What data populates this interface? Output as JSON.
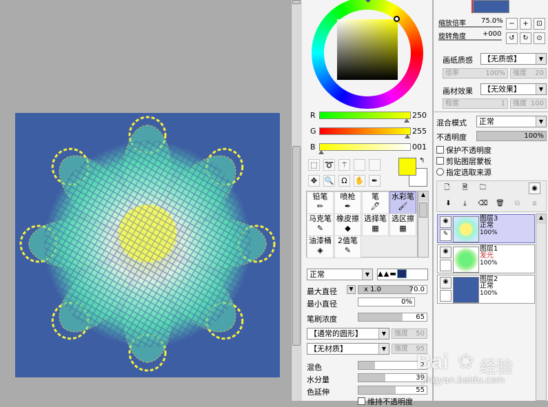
{
  "colors": {
    "canvas_bg": "#3e5ea3",
    "primary_color": "#fafa00",
    "secondary_color": "#ffffff",
    "selected_bg": "#c8c8f0"
  },
  "rgb": {
    "r_label": "R",
    "r_value": "250",
    "g_label": "G",
    "g_value": "255",
    "b_label": "B",
    "b_value": "001"
  },
  "tools": [
    {
      "label": "铅笔",
      "icon": "pencil-icon",
      "glyph": "✏"
    },
    {
      "label": "喷枪",
      "icon": "airbrush-icon",
      "glyph": "✒"
    },
    {
      "label": "笔",
      "icon": "pen-icon",
      "glyph": "🖊"
    },
    {
      "label": "水彩笔",
      "icon": "watercolor-icon",
      "glyph": "🖌",
      "selected": true
    },
    {
      "label": "马克笔",
      "icon": "marker-icon",
      "glyph": "✎"
    },
    {
      "label": "橡皮擦",
      "icon": "eraser-icon",
      "glyph": "◆"
    },
    {
      "label": "选择笔",
      "icon": "selection-pen-icon",
      "glyph": "▦"
    },
    {
      "label": "选区擦",
      "icon": "selection-eraser-icon",
      "glyph": "▦"
    },
    {
      "label": "油漆桶",
      "icon": "bucket-icon",
      "glyph": "◈"
    },
    {
      "label": "2值笔",
      "icon": "binary-pen-icon",
      "glyph": "✎"
    }
  ],
  "brush": {
    "blend_mode": "正常",
    "max_diameter_label": "最大直径",
    "max_diameter_mult": "x 1.0",
    "max_diameter_value": "70.0",
    "min_diameter_label": "最小直径",
    "min_diameter_value": "0%",
    "density_label": "笔刷浓度",
    "density_value": "65",
    "shape": "【通常的圆形】",
    "shape_strength_label": "强度",
    "shape_strength_value": "50",
    "texture": "【无材质】",
    "texture_strength_label": "强度",
    "texture_strength_value": "95",
    "mix_label": "混色",
    "mix_value": "2",
    "water_label": "水分量",
    "water_value": "39",
    "stretch_label": "色延伸",
    "stretch_value": "55",
    "keep_opacity_label": "维持不透明度",
    "mix_level": 0.1,
    "water_level": 0.39,
    "stretch_level": 0.55,
    "density_level": 0.65
  },
  "navigator": {
    "zoom_label": "缩放倍率",
    "zoom_value": "75.0%",
    "rotate_label": "旋转角度",
    "rotate_value": "+000"
  },
  "paper": {
    "quality_label": "画纸质感",
    "quality_value": "【无质感】",
    "scale_label": "倍率",
    "scale_value": "100%",
    "strength_label": "强度",
    "strength_value": "20",
    "effect_label": "画材效果",
    "effect_value": "【无效果】",
    "degree_label": "程度",
    "degree_value": "1",
    "effect_strength_label": "强度",
    "effect_strength_value": "100"
  },
  "layer_props": {
    "blend_label": "混合模式",
    "blend_value": "正常",
    "opacity_label": "不透明度",
    "opacity_value": "100%",
    "protect_opacity": "保护不透明度",
    "clip_group": "剪贴图层蒙板",
    "selection_source": "指定选取来源"
  },
  "layers": [
    {
      "name": "图层3",
      "mode": "正常",
      "opacity": "100%",
      "selected": true
    },
    {
      "name": "图层1",
      "mode": "发光",
      "opacity": "100%"
    },
    {
      "name": "图层2",
      "mode": "正常",
      "opacity": "100%"
    }
  ],
  "watermark": {
    "brand_left": "Bai",
    "brand_right": "经验",
    "url": "jingyan.baidu.com"
  }
}
